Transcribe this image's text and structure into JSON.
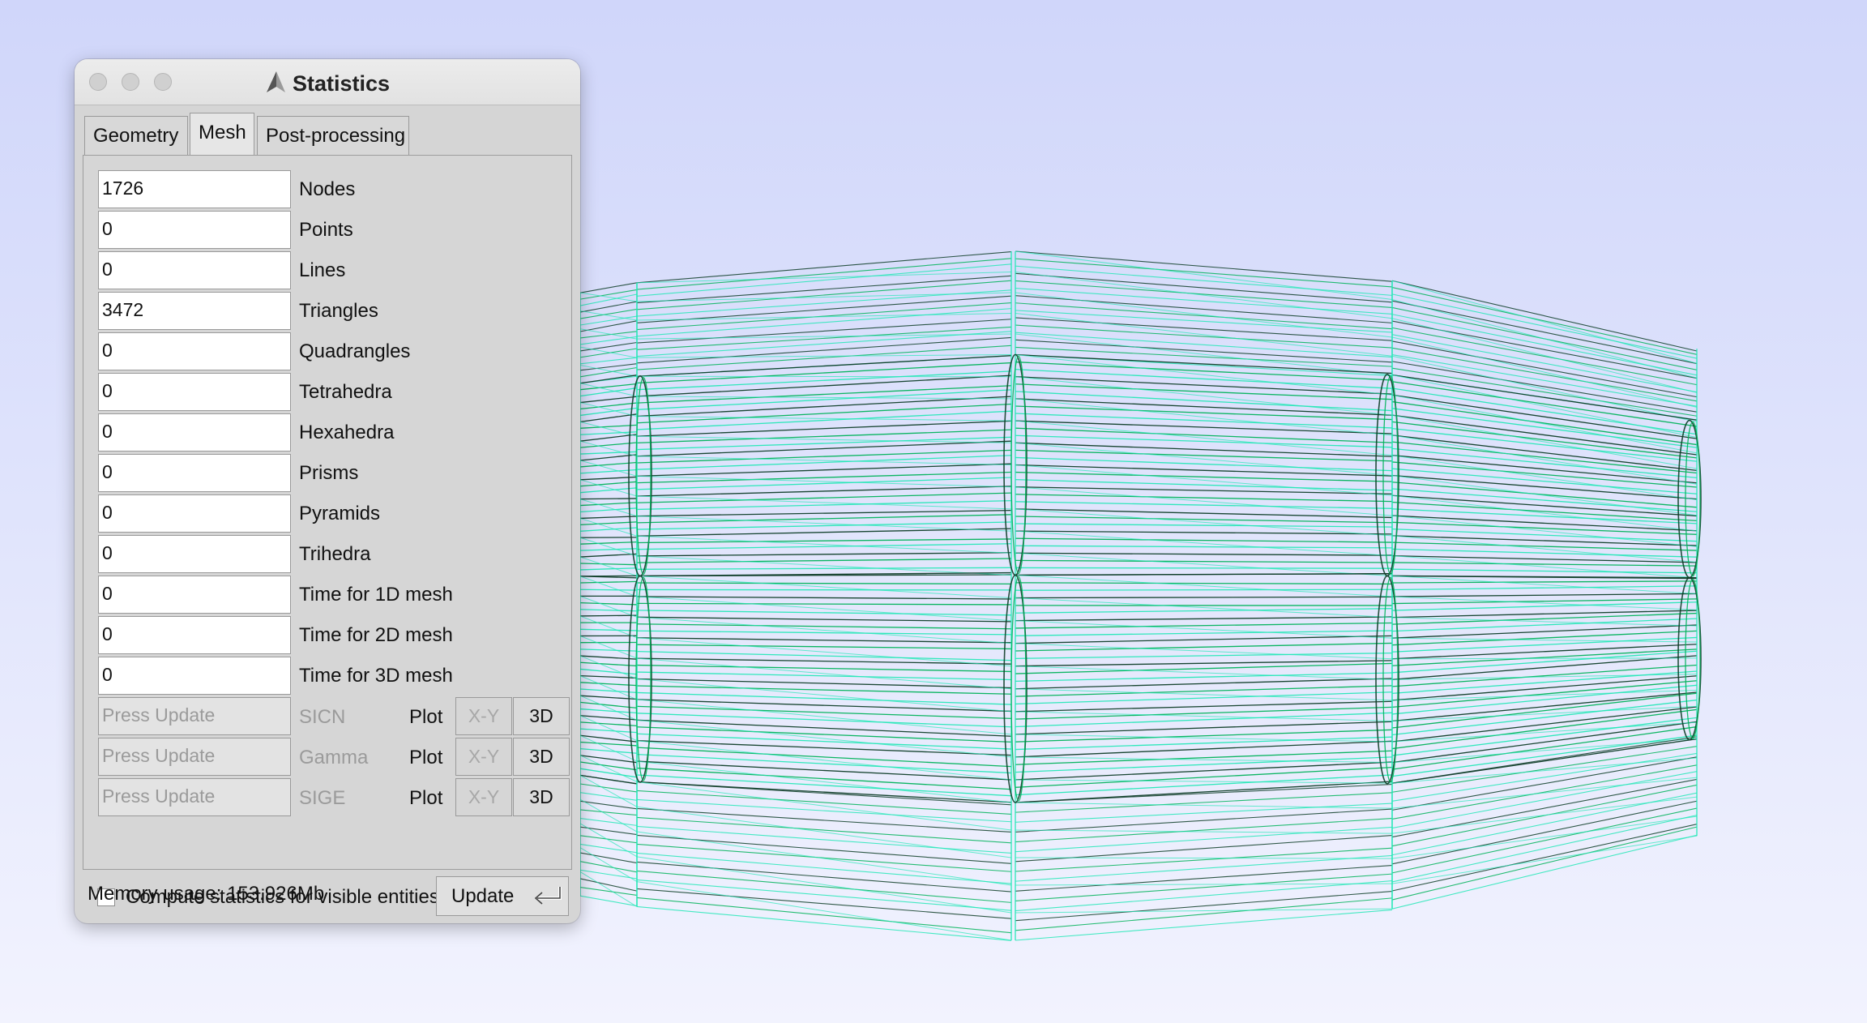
{
  "window": {
    "title": "Statistics",
    "tabs": [
      "Geometry",
      "Mesh",
      "Post-processing"
    ],
    "active_tab": "Mesh"
  },
  "stats": [
    {
      "value": "1726",
      "label": "Nodes"
    },
    {
      "value": "0",
      "label": "Points"
    },
    {
      "value": "0",
      "label": "Lines"
    },
    {
      "value": "3472",
      "label": "Triangles"
    },
    {
      "value": "0",
      "label": "Quadrangles"
    },
    {
      "value": "0",
      "label": "Tetrahedra"
    },
    {
      "value": "0",
      "label": "Hexahedra"
    },
    {
      "value": "0",
      "label": "Prisms"
    },
    {
      "value": "0",
      "label": "Pyramids"
    },
    {
      "value": "0",
      "label": "Trihedra"
    },
    {
      "value": "0",
      "label": "Time for 1D mesh"
    },
    {
      "value": "0",
      "label": "Time for 2D mesh"
    },
    {
      "value": "0",
      "label": "Time for 3D mesh"
    }
  ],
  "quality": [
    {
      "value": "Press Update",
      "measure": "SICN",
      "plot": "Plot",
      "xy": "X-Y",
      "three_d": "3D"
    },
    {
      "value": "Press Update",
      "measure": "Gamma",
      "plot": "Plot",
      "xy": "X-Y",
      "three_d": "3D"
    },
    {
      "value": "Press Update",
      "measure": "SIGE",
      "plot": "Plot",
      "xy": "X-Y",
      "three_d": "3D"
    }
  ],
  "visible_only": {
    "label": "Compute statistics for visible entities only",
    "checked": false
  },
  "memory": "Memory usage: 153.926Mb",
  "update_button": "Update",
  "colors": {
    "mesh_green": "#00b35a",
    "mesh_dark": "#0d3d27",
    "mesh_cyan": "#26e8b8",
    "background_top": "#d0d6fa",
    "background_bottom": "#f2f3fe"
  }
}
